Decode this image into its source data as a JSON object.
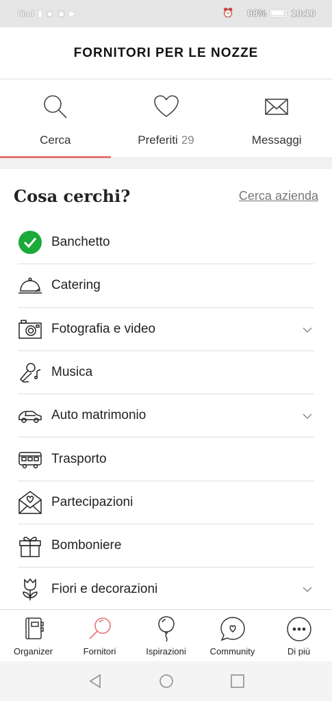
{
  "status_bar": {
    "carrier": "Iliad",
    "battery_pct": "88%",
    "time": "10:10"
  },
  "header": {
    "title": "FORNITORI PER LE NOZZE"
  },
  "tabs": [
    {
      "label": "Cerca",
      "icon": "search-icon",
      "active": true
    },
    {
      "label": "Preferiti",
      "count": "29",
      "icon": "heart-icon",
      "active": false
    },
    {
      "label": "Messaggi",
      "icon": "envelope-icon",
      "active": false
    }
  ],
  "section": {
    "title": "Cosa cerchi?",
    "link": "Cerca azienda"
  },
  "categories": [
    {
      "label": "Banchetto",
      "icon": "check-circle-icon",
      "selected": true,
      "expandable": false
    },
    {
      "label": "Catering",
      "icon": "cloche-icon",
      "expandable": false
    },
    {
      "label": "Fotografia e video",
      "icon": "camera-icon",
      "expandable": true
    },
    {
      "label": "Musica",
      "icon": "microphone-icon",
      "expandable": false
    },
    {
      "label": "Auto matrimonio",
      "icon": "car-icon",
      "expandable": true
    },
    {
      "label": "Trasporto",
      "icon": "bus-icon",
      "expandable": false
    },
    {
      "label": "Partecipazioni",
      "icon": "invitation-icon",
      "expandable": false
    },
    {
      "label": "Bomboniere",
      "icon": "gift-icon",
      "expandable": false
    },
    {
      "label": "Fiori e decorazioni",
      "icon": "tulip-icon",
      "expandable": true
    }
  ],
  "bottom_nav": [
    {
      "label": "Organizer",
      "icon": "organizer-book-icon",
      "active": false
    },
    {
      "label": "Fornitori",
      "icon": "magnifier-icon",
      "active": true
    },
    {
      "label": "Ispirazioni",
      "icon": "balloon-icon",
      "active": false
    },
    {
      "label": "Community",
      "icon": "chat-heart-icon",
      "active": false
    },
    {
      "label": "Di più",
      "icon": "more-dots-icon",
      "active": false
    }
  ],
  "colors": {
    "accent": "#e57373",
    "check_green": "#1aaa3a",
    "text": "#222222"
  }
}
